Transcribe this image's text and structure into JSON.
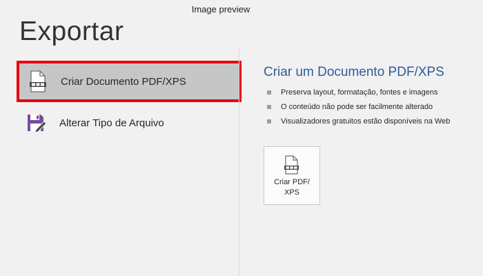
{
  "window": {
    "title": "Image preview"
  },
  "page": {
    "title": "Exportar"
  },
  "left_panel": {
    "options": [
      {
        "label": "Criar Documento PDF/XPS",
        "icon": "pdf-document-icon",
        "selected": true
      },
      {
        "label": "Alterar Tipo de Arquivo",
        "icon": "save-as-file-type-icon",
        "selected": false
      }
    ]
  },
  "right_panel": {
    "title": "Criar um Documento PDF/XPS",
    "bullets": [
      "Preserva layout, formatação, fontes e imagens",
      "O conteúdo não pode ser facilmente alterado",
      "Visualizadores gratuitos estão disponíveis na Web"
    ],
    "button": {
      "label_line1": "Criar PDF/",
      "label_line2": "XPS",
      "icon": "pdf-document-icon"
    }
  },
  "colors": {
    "background": "#f1f1f1",
    "selected_background": "#c6c6c6",
    "highlight_border": "#e8000e",
    "accent_title": "#2e5c9a",
    "save_icon_purple": "#7a4b9c"
  }
}
